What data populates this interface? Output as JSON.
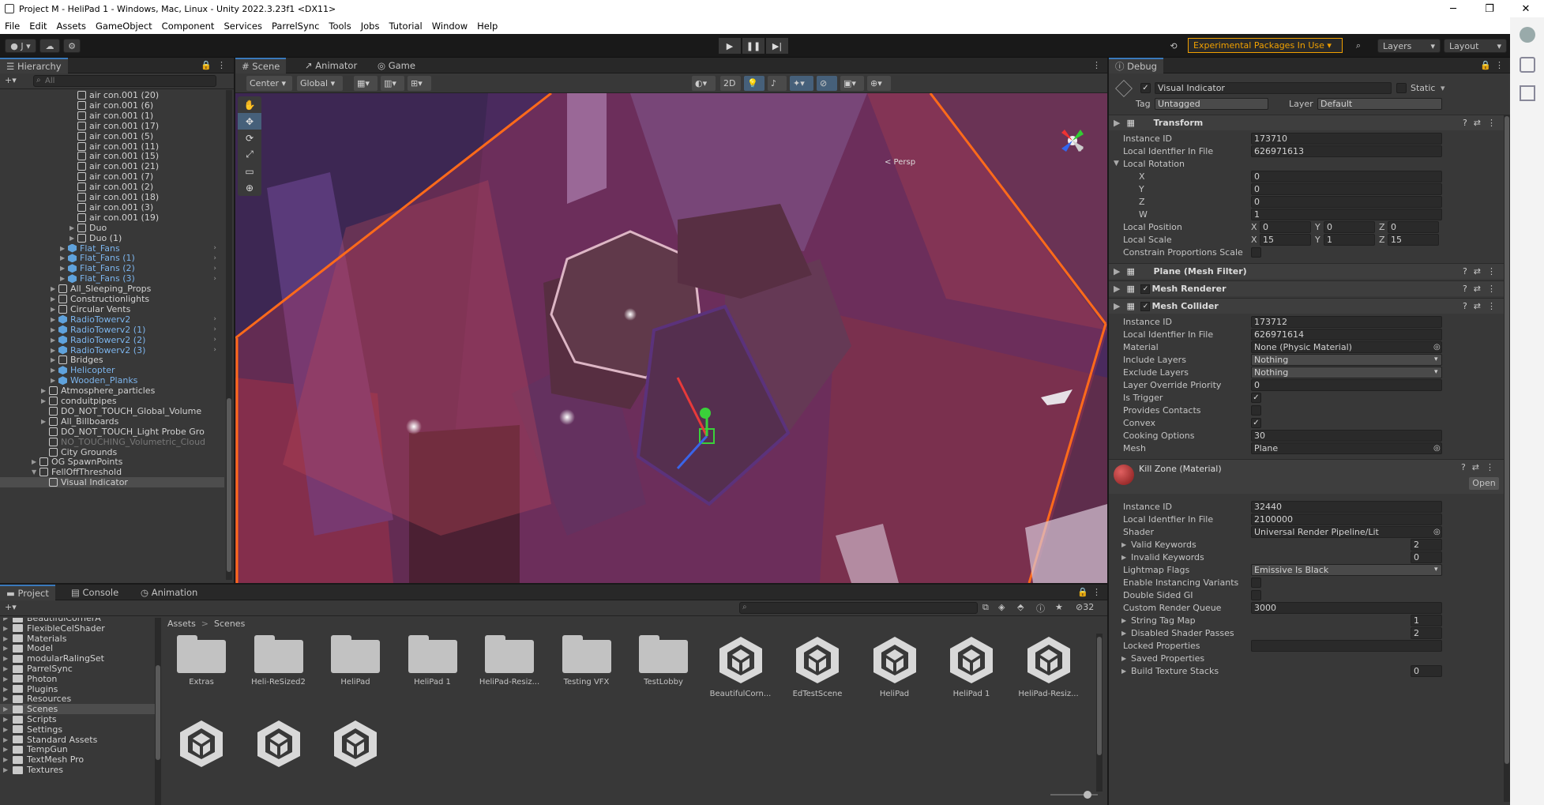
{
  "window": {
    "title": "Project M - HeliPad 1 - Windows, Mac, Linux - Unity 2022.3.23f1 <DX11>",
    "controls": [
      "─",
      "❐",
      "✕"
    ]
  },
  "menu": [
    "File",
    "Edit",
    "Assets",
    "GameObject",
    "Component",
    "Services",
    "ParrelSync",
    "Tools",
    "Jobs",
    "Tutorial",
    "Window",
    "Help"
  ],
  "toolbar": {
    "account": "J",
    "experimental": "Experimental Packages In Use ▾",
    "layers": "Layers",
    "layout": "Layout"
  },
  "hierarchy": {
    "tab": "Hierarchy",
    "search_placeholder": "All",
    "items": [
      {
        "label": "air con.001 (20)",
        "indent": 3,
        "type": "go"
      },
      {
        "label": "air con.001 (6)",
        "indent": 3,
        "type": "go"
      },
      {
        "label": "air con.001 (1)",
        "indent": 3,
        "type": "go"
      },
      {
        "label": "air con.001 (17)",
        "indent": 3,
        "type": "go"
      },
      {
        "label": "air con.001 (5)",
        "indent": 3,
        "type": "go"
      },
      {
        "label": "air con.001 (11)",
        "indent": 3,
        "type": "go"
      },
      {
        "label": "air con.001 (15)",
        "indent": 3,
        "type": "go"
      },
      {
        "label": "air con.001 (21)",
        "indent": 3,
        "type": "go"
      },
      {
        "label": "air con.001 (7)",
        "indent": 3,
        "type": "go"
      },
      {
        "label": "air con.001 (2)",
        "indent": 3,
        "type": "go"
      },
      {
        "label": "air con.001 (18)",
        "indent": 3,
        "type": "go"
      },
      {
        "label": "air con.001 (3)",
        "indent": 3,
        "type": "go"
      },
      {
        "label": "air con.001 (19)",
        "indent": 3,
        "type": "go"
      },
      {
        "label": "Duo",
        "indent": 3,
        "type": "go",
        "arrow": "▶"
      },
      {
        "label": "Duo (1)",
        "indent": 3,
        "type": "go",
        "arrow": "▶"
      },
      {
        "label": "Flat_Fans",
        "indent": 2,
        "type": "prefab",
        "arrow": "▶",
        "child": "›"
      },
      {
        "label": "Flat_Fans (1)",
        "indent": 2,
        "type": "prefab",
        "arrow": "▶",
        "child": "›"
      },
      {
        "label": "Flat_Fans (2)",
        "indent": 2,
        "type": "prefab",
        "arrow": "▶",
        "child": "›"
      },
      {
        "label": "Flat_Fans (3)",
        "indent": 2,
        "type": "prefab",
        "arrow": "▶",
        "child": "›"
      },
      {
        "label": "All_Sleeping_Props",
        "indent": 1,
        "type": "go",
        "arrow": "▶"
      },
      {
        "label": "Constructionlights",
        "indent": 1,
        "type": "go",
        "arrow": "▶"
      },
      {
        "label": "Circular Vents",
        "indent": 1,
        "type": "go",
        "arrow": "▶"
      },
      {
        "label": "RadioTowerv2",
        "indent": 1,
        "type": "prefab",
        "arrow": "▶",
        "child": "›"
      },
      {
        "label": "RadioTowerv2 (1)",
        "indent": 1,
        "type": "prefab",
        "arrow": "▶",
        "child": "›"
      },
      {
        "label": "RadioTowerv2 (2)",
        "indent": 1,
        "type": "prefab",
        "arrow": "▶",
        "child": "›"
      },
      {
        "label": "RadioTowerv2 (3)",
        "indent": 1,
        "type": "prefab",
        "arrow": "▶",
        "child": "›"
      },
      {
        "label": "Bridges",
        "indent": 1,
        "type": "go",
        "arrow": "▶"
      },
      {
        "label": "Helicopter",
        "indent": 1,
        "type": "prefab",
        "arrow": "▶"
      },
      {
        "label": "Wooden_Planks",
        "indent": 1,
        "type": "prefab",
        "arrow": "▶"
      },
      {
        "label": "Atmosphere_particles",
        "indent": 0,
        "type": "go",
        "arrow": "▶"
      },
      {
        "label": "conduitpipes",
        "indent": 0,
        "type": "go",
        "arrow": "▶"
      },
      {
        "label": "DO_NOT_TOUCH_Global_Volume",
        "indent": 0,
        "type": "go"
      },
      {
        "label": "All_Billboards",
        "indent": 0,
        "type": "go",
        "arrow": "▶"
      },
      {
        "label": "DO_NOT_TOUCH_Light Probe Gro",
        "indent": 0,
        "type": "go"
      },
      {
        "label": "NO_TOUCHING_Volumetric_Cloud",
        "indent": 0,
        "type": "go",
        "dim": true
      },
      {
        "label": "City Grounds",
        "indent": 0,
        "type": "go"
      },
      {
        "label": "OG SpawnPoints",
        "indent": -1,
        "type": "go",
        "arrow": "▶"
      },
      {
        "label": "FellOffThreshold",
        "indent": -1,
        "type": "go",
        "arrow": "▼"
      },
      {
        "label": "Visual Indicator",
        "indent": 0,
        "type": "go",
        "selected": true
      }
    ]
  },
  "scene": {
    "tabs": [
      "Scene",
      "Animator",
      "Game"
    ],
    "pivot": "Center",
    "space": "Global",
    "mode2d": "2D",
    "persp": "< Persp",
    "tools": [
      "✋",
      "✥",
      "⟳",
      "⤢",
      "▭",
      "⊕"
    ]
  },
  "inspector": {
    "tab": "Debug",
    "object_name": "Visual Indicator",
    "static_label": "Static",
    "tag_label": "Tag",
    "tag": "Untagged",
    "layer_label": "Layer",
    "layer": "Default",
    "transform": {
      "title": "Transform",
      "rows": [
        {
          "label": "Instance ID",
          "value": "173710"
        },
        {
          "label": "Local Identfier In File",
          "value": "626971613"
        }
      ],
      "local_rotation": "Local Rotation",
      "rot": [
        {
          "label": "X",
          "value": "0"
        },
        {
          "label": "Y",
          "value": "0"
        },
        {
          "label": "Z",
          "value": "0"
        },
        {
          "label": "W",
          "value": "1"
        }
      ],
      "pos_label": "Local Position",
      "pos": {
        "x": "0",
        "y": "0",
        "z": "0"
      },
      "scale_label": "Local Scale",
      "scale": {
        "x": "15",
        "y": "1",
        "z": "15"
      },
      "constrain": "Constrain Proportions Scale"
    },
    "plane": "Plane (Mesh Filter)",
    "renderer": "Mesh Renderer",
    "collider": {
      "title": "Mesh Collider",
      "rows": [
        {
          "label": "Instance ID",
          "value": "173712",
          "kind": "text"
        },
        {
          "label": "Local Identfier In File",
          "value": "626971614",
          "kind": "text"
        },
        {
          "label": "Material",
          "value": "None (Physic Material)",
          "kind": "obj"
        },
        {
          "label": "Include Layers",
          "value": "Nothing",
          "kind": "drop"
        },
        {
          "label": "Exclude Layers",
          "value": "Nothing",
          "kind": "drop"
        },
        {
          "label": "Layer Override Priority",
          "value": "0",
          "kind": "text"
        },
        {
          "label": "Is Trigger",
          "value": "✓",
          "kind": "chk"
        },
        {
          "label": "Provides Contacts",
          "value": "",
          "kind": "chk"
        },
        {
          "label": "Convex",
          "value": "✓",
          "kind": "chk"
        },
        {
          "label": "Cooking Options",
          "value": "30",
          "kind": "text"
        },
        {
          "label": "Mesh",
          "value": "Plane",
          "kind": "obj"
        }
      ]
    },
    "material": {
      "title": "Kill Zone (Material)",
      "open": "Open",
      "rows": [
        {
          "label": "Instance ID",
          "value": "32440",
          "kind": "text"
        },
        {
          "label": "Local Identfier In File",
          "value": "2100000",
          "kind": "text"
        },
        {
          "label": "Shader",
          "value": "Universal Render Pipeline/Lit",
          "kind": "obj"
        },
        {
          "label": "Valid Keywords",
          "value": "2",
          "kind": "small",
          "arrow": true
        },
        {
          "label": "Invalid Keywords",
          "value": "0",
          "kind": "small",
          "arrow": true
        },
        {
          "label": "Lightmap Flags",
          "value": "Emissive Is Black",
          "kind": "drop"
        },
        {
          "label": "Enable Instancing Variants",
          "value": "",
          "kind": "chk"
        },
        {
          "label": "Double Sided GI",
          "value": "",
          "kind": "chk"
        },
        {
          "label": "Custom Render Queue",
          "value": "3000",
          "kind": "text"
        },
        {
          "label": "String Tag Map",
          "value": "1",
          "kind": "small",
          "arrow": true
        },
        {
          "label": "Disabled Shader Passes",
          "value": "2",
          "kind": "small",
          "arrow": true
        },
        {
          "label": "Locked Properties",
          "value": "",
          "kind": "text"
        },
        {
          "label": "Saved Properties",
          "value": "",
          "kind": "none",
          "arrow": true
        },
        {
          "label": "Build Texture Stacks",
          "value": "0",
          "kind": "small",
          "arrow": true
        }
      ]
    }
  },
  "project": {
    "tabs": [
      "Project",
      "Console",
      "Animation"
    ],
    "breadcrumb": [
      "Assets",
      "Scenes"
    ],
    "visible_count": "32",
    "tree": [
      "BeautifulCornerA",
      "FlexibleCelShader",
      "Materials",
      "Model",
      "modularRalingSet",
      "ParrelSync",
      "Photon",
      "Plugins",
      "Resources",
      "Scenes",
      "Scripts",
      "Settings",
      "Standard Assets",
      "TempGun",
      "TextMesh Pro",
      "Textures"
    ],
    "selected": "Scenes",
    "assets": [
      {
        "name": "Extras",
        "kind": "folder"
      },
      {
        "name": "Heli-ReSized2",
        "kind": "folder"
      },
      {
        "name": "HeliPad",
        "kind": "folder"
      },
      {
        "name": "HeliPad 1",
        "kind": "folder"
      },
      {
        "name": "HeliPad-Resiz...",
        "kind": "folder"
      },
      {
        "name": "Testing VFX",
        "kind": "folder"
      },
      {
        "name": "TestLobby",
        "kind": "folder"
      },
      {
        "name": "BeautifulCorn...",
        "kind": "scene"
      },
      {
        "name": "EdTestScene",
        "kind": "scene"
      },
      {
        "name": "HeliPad",
        "kind": "scene"
      },
      {
        "name": "HeliPad 1",
        "kind": "scene"
      },
      {
        "name": "HeliPad-Resiz...",
        "kind": "scene"
      },
      {
        "name": "",
        "kind": "scene"
      },
      {
        "name": "",
        "kind": "scene"
      },
      {
        "name": "",
        "kind": "scene"
      }
    ]
  }
}
